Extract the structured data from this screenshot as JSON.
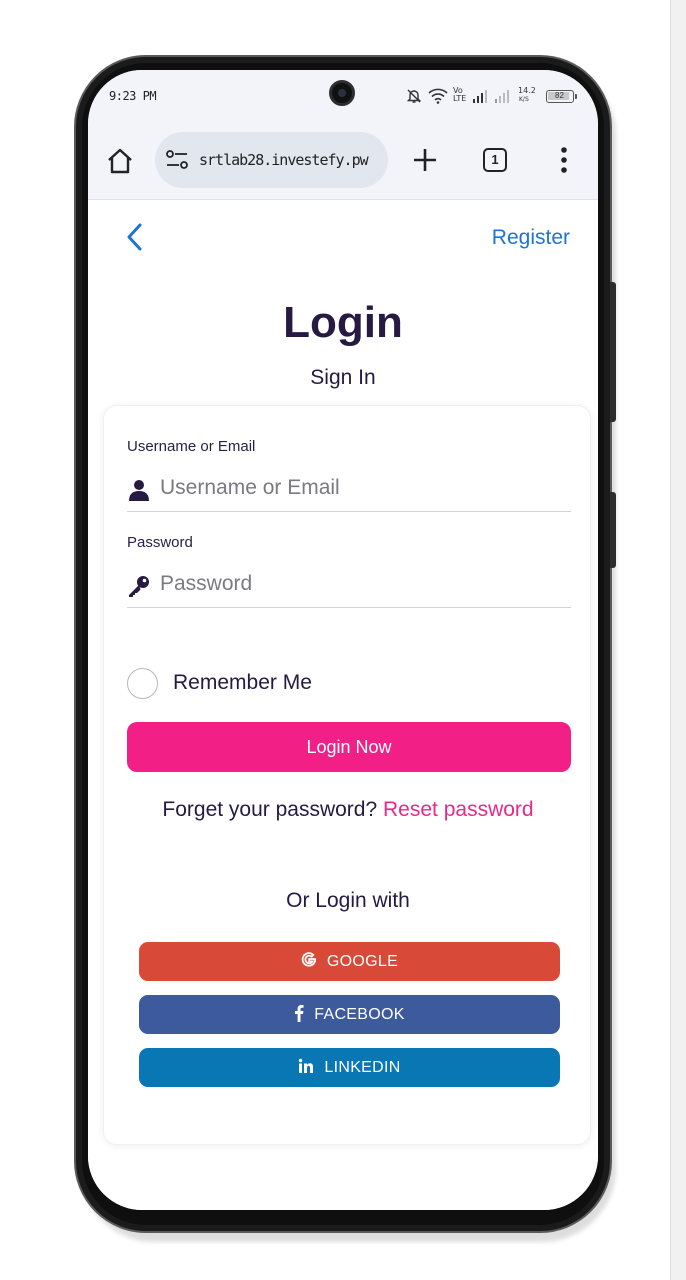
{
  "status_bar": {
    "time": "9:23 PM",
    "network_type": "Vo LTE",
    "speed_value": "14.2",
    "speed_unit": "K/S",
    "battery": "82"
  },
  "browser": {
    "url": "srtlab28.investefy.pw",
    "tab_count": "1"
  },
  "header": {
    "register_label": "Register"
  },
  "login": {
    "title": "Login",
    "subtitle": "Sign In",
    "username_label": "Username or Email",
    "username_placeholder": "Username or Email",
    "password_label": "Password",
    "password_placeholder": "Password",
    "remember_label": "Remember Me",
    "submit_label": "Login Now",
    "forgot_text": "Forget your password?",
    "reset_link": "Reset password",
    "or_login_with": "Or Login with"
  },
  "social": {
    "google": "GOOGLE",
    "facebook": "FACEBOOK",
    "linkedin": "LINKEDIN"
  },
  "colors": {
    "primary_pink": "#f21f86",
    "link_blue": "#1e73d6",
    "heading": "#261a43",
    "google": "#d84a37",
    "facebook": "#3c5a9c",
    "linkedin": "#0a77b5"
  }
}
